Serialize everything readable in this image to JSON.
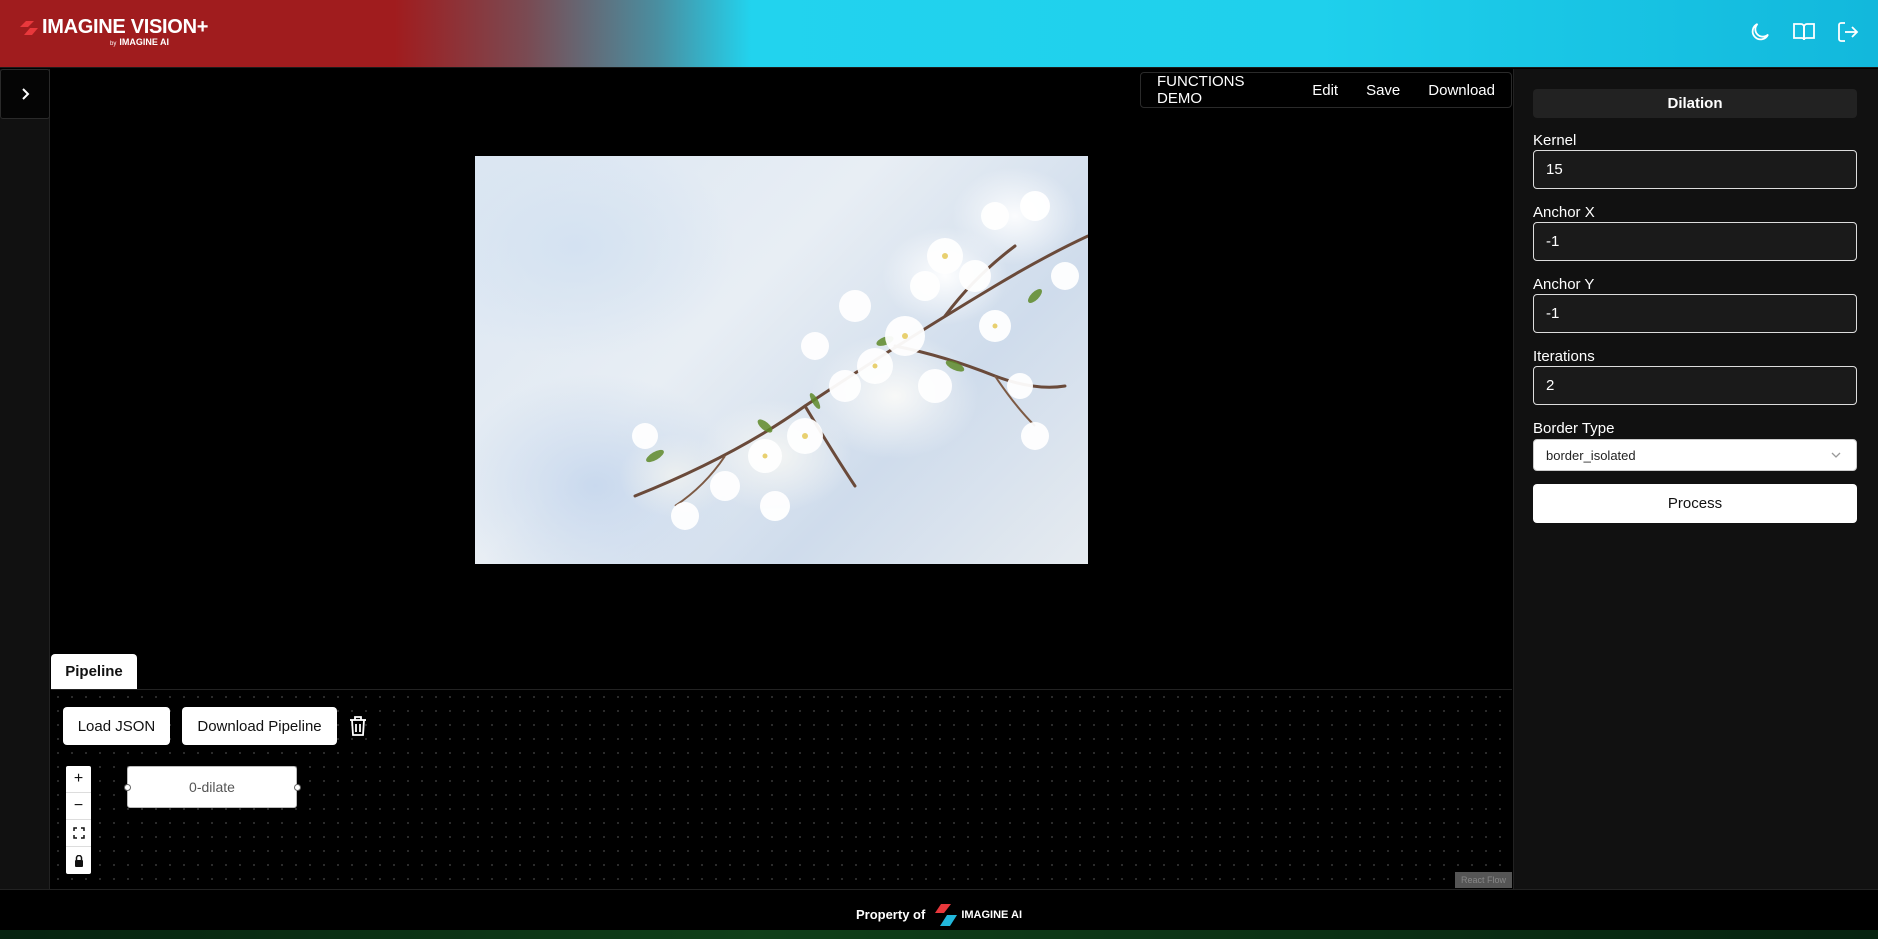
{
  "header": {
    "brand": "IMAGINE VISION+",
    "brand_sub_prefix": "by",
    "brand_sub": "IMAGINE AI",
    "icons": [
      "moon-icon",
      "book-icon",
      "logout-icon"
    ]
  },
  "toolbar": {
    "demo_label": "FUNCTIONS DEMO",
    "edit_label": "Edit",
    "save_label": "Save",
    "download_label": "Download"
  },
  "pipeline": {
    "tab_label": "Pipeline",
    "load_json_label": "Load JSON",
    "download_pipeline_label": "Download Pipeline",
    "node_label": "0-dilate",
    "attribution": "React Flow"
  },
  "panel": {
    "title": "Dilation",
    "fields": [
      {
        "label": "Kernel",
        "value": "15"
      },
      {
        "label": "Anchor X",
        "value": "-1"
      },
      {
        "label": "Anchor Y",
        "value": "-1"
      },
      {
        "label": "Iterations",
        "value": "2"
      }
    ],
    "border_type_label": "Border Type",
    "border_type_value": "border_isolated",
    "process_label": "Process"
  },
  "footer": {
    "text": "Property of",
    "logo_text": "IMAGINE AI"
  },
  "colors": {
    "brand_red": "#a01c1e",
    "brand_cyan": "#22d3ee"
  }
}
